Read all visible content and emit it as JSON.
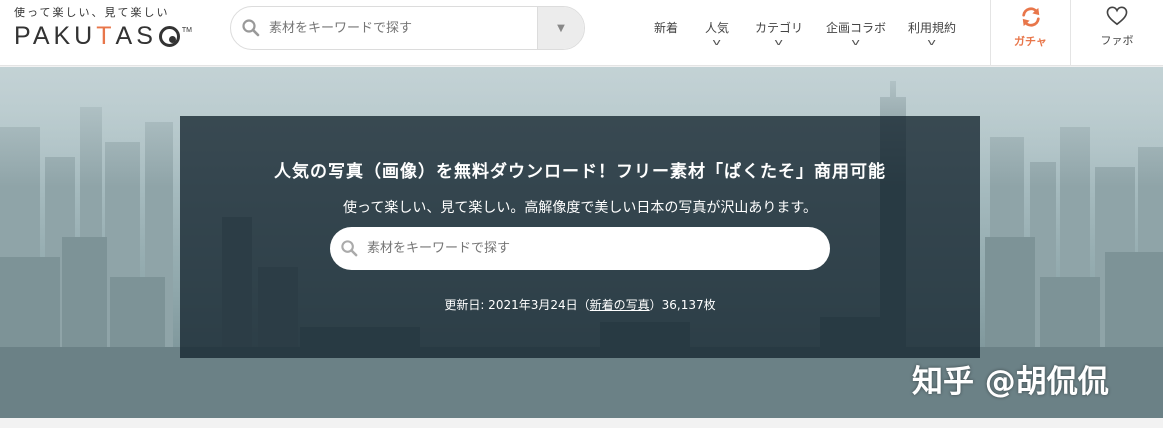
{
  "logo": {
    "tagline": "使って楽しい、見て楽しい",
    "wordmark_start": "PAKU",
    "wordmark_accent": "T",
    "wordmark_end": "AS",
    "trademark": "TM"
  },
  "header_search": {
    "placeholder": "素材をキーワードで探す",
    "dropdown_icon": "caret-down-icon"
  },
  "nav": {
    "items": [
      {
        "label": "新着",
        "has_submenu": false
      },
      {
        "label": "人気",
        "has_submenu": true
      },
      {
        "label": "カテゴリ",
        "has_submenu": true
      },
      {
        "label": "企画コラボ",
        "has_submenu": true
      },
      {
        "label": "利用規約",
        "has_submenu": true
      }
    ],
    "submenu_glyph": "v"
  },
  "gacha": {
    "label": "ガチャ",
    "icon": "refresh-icon"
  },
  "favorite": {
    "label": "ファボ",
    "icon": "heart-icon"
  },
  "hero": {
    "title": "人気の写真（画像）を無料ダウンロード！フリー素材「ぱくたそ」商用可能",
    "subtitle": "使って楽しい、見て楽しい。高解像度で美しい日本の写真が沢山あります。",
    "search_placeholder": "素材をキーワードで探す",
    "updated_prefix": "更新日: 2021年3月24日（",
    "updated_link": "新着の写真",
    "updated_suffix": "）36,137枚"
  },
  "watermark": "知乎 @胡侃侃",
  "colors": {
    "accent": "#e8764a",
    "panel_bg": "#182832",
    "header_bg": "#ffffff"
  }
}
